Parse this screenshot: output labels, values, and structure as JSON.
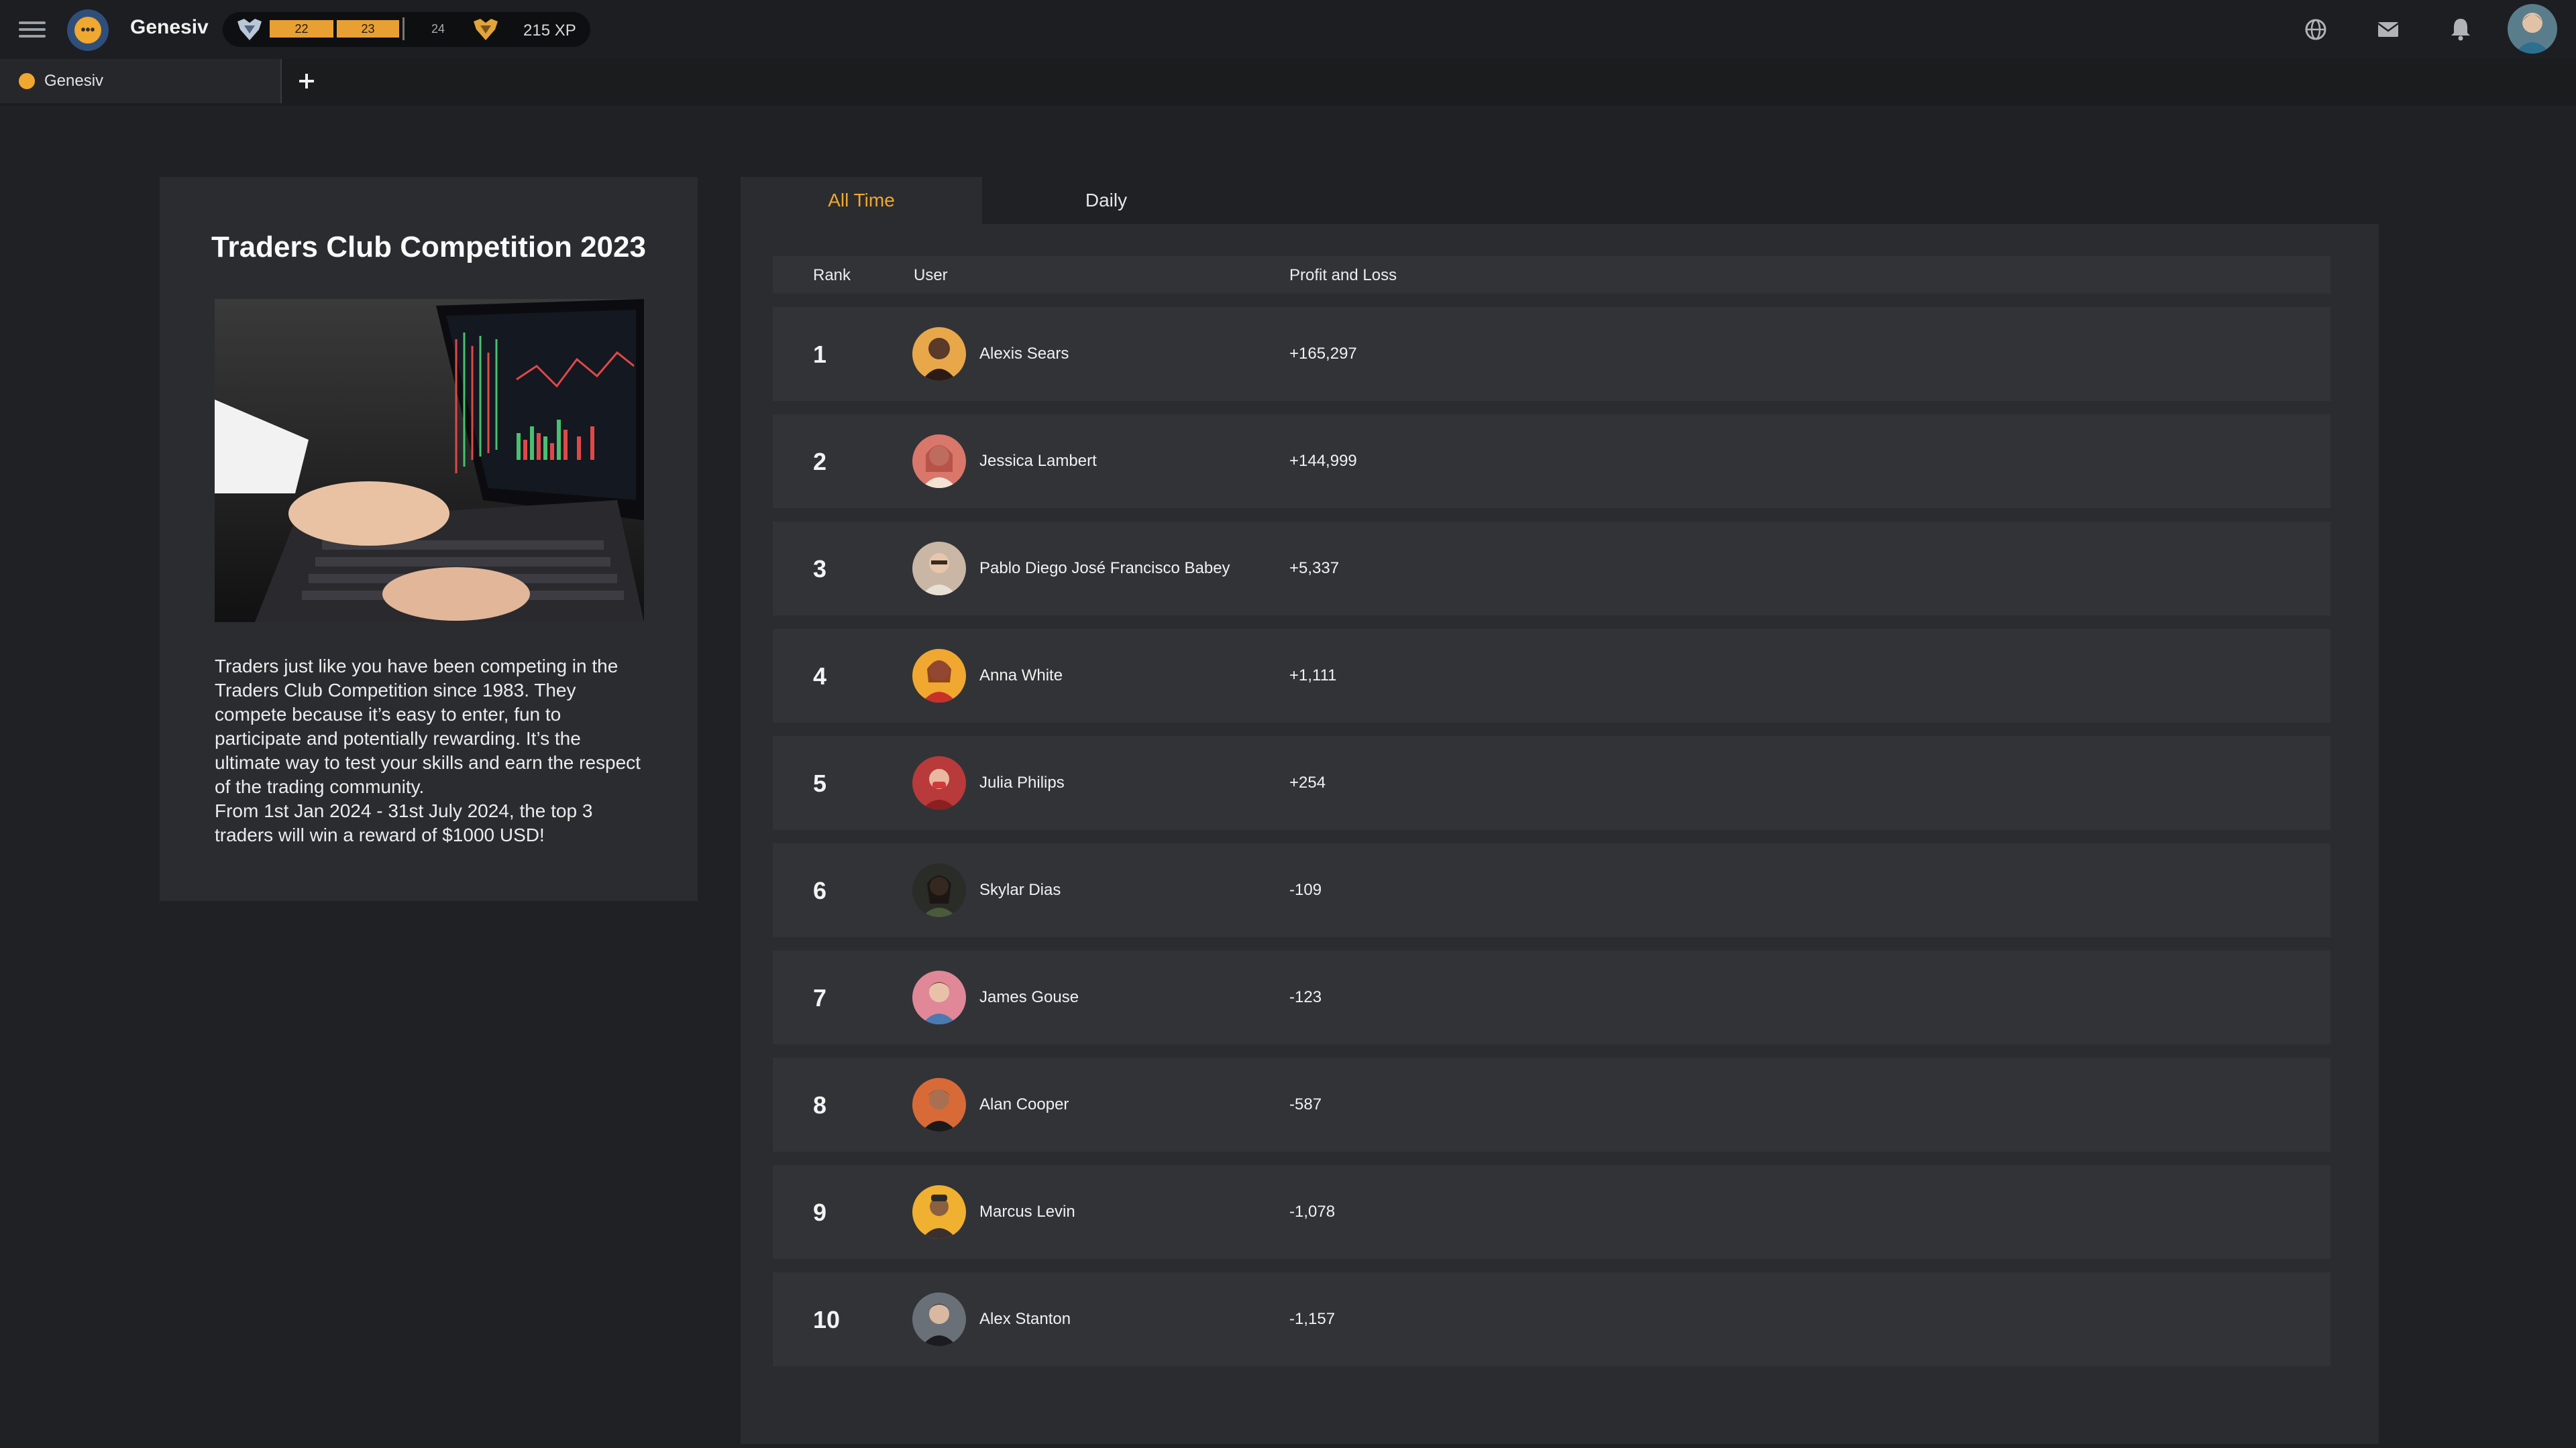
{
  "app": {
    "name": "Genesiv"
  },
  "xp_bar": {
    "levels": [
      "22",
      "23",
      "24"
    ],
    "xp_text": "215 XP",
    "level_progress": 0.66
  },
  "tabs": [
    {
      "label": "Genesiv"
    }
  ],
  "competition": {
    "title": "Traders Club Competition 2023",
    "description": "Traders just like you have been competing in the Traders Club Competition since 1983. They compete because it’s easy to enter, fun to participate and potentially rewarding. It’s the ultimate way to test your skills and earn the respect of the trading community.",
    "reward_text": "From 1st Jan 2024 - 31st July 2024, the top 3 traders will win a reward of $1000 USD!"
  },
  "leaderboard": {
    "tabs": [
      "All Time",
      "Daily"
    ],
    "active_tab": "All Time",
    "columns": [
      "Rank",
      "User",
      "Profit and Loss"
    ],
    "rows": [
      {
        "rank": "1",
        "user": "Alexis Sears",
        "pnl": "+165,297"
      },
      {
        "rank": "2",
        "user": "Jessica Lambert",
        "pnl": "+144,999"
      },
      {
        "rank": "3",
        "user": "Pablo Diego José Francisco Babey",
        "pnl": "+5,337"
      },
      {
        "rank": "4",
        "user": "Anna White",
        "pnl": "+1,111"
      },
      {
        "rank": "5",
        "user": "Julia Philips",
        "pnl": "+254"
      },
      {
        "rank": "6",
        "user": "Skylar Dias",
        "pnl": "-109"
      },
      {
        "rank": "7",
        "user": "James Gouse",
        "pnl": "-123"
      },
      {
        "rank": "8",
        "user": "Alan Cooper",
        "pnl": "-587"
      },
      {
        "rank": "9",
        "user": "Marcus Levin",
        "pnl": "-1,078"
      },
      {
        "rank": "10",
        "user": "Alex Stanton",
        "pnl": "-1,157"
      }
    ]
  },
  "colors": {
    "accent": "#f0a830",
    "background": "#202124",
    "panel": "#2b2c30",
    "row": "#323337"
  }
}
